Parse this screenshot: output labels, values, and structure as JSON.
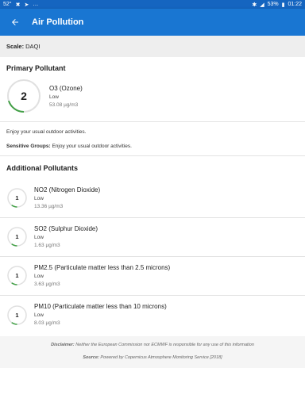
{
  "status_bar": {
    "left_text": "52°",
    "icons": [
      "notification-x-icon",
      "location-icon",
      "more-icon"
    ],
    "battery": "53%",
    "time": "01:22"
  },
  "app_bar": {
    "title": "Air Pollution"
  },
  "scale": {
    "label": "Scale:",
    "value": "DAQI"
  },
  "primary": {
    "heading": "Primary Pollutant",
    "index": "2",
    "index_fraction": 0.2,
    "name": "O3 (Ozone)",
    "level": "Low",
    "value": "53.08 µg/m3"
  },
  "advice": {
    "general": "Enjoy your usual outdoor activities.",
    "sensitive_label": "Sensitive Groups:",
    "sensitive_text": "Enjoy your usual outdoor activities."
  },
  "additional": {
    "heading": "Additional Pollutants",
    "items": [
      {
        "index": "1",
        "index_fraction": 0.1,
        "name": "NO2 (Nitrogen Dioxide)",
        "level": "Low",
        "value": "13.36 µg/m3"
      },
      {
        "index": "1",
        "index_fraction": 0.1,
        "name": "SO2 (Sulphur Dioxide)",
        "level": "Low",
        "value": "1.63 µg/m3"
      },
      {
        "index": "1",
        "index_fraction": 0.1,
        "name": "PM2.5 (Particulate matter less than 2.5 microns)",
        "level": "Low",
        "value": "3.63 µg/m3"
      },
      {
        "index": "1",
        "index_fraction": 0.1,
        "name": "PM10 (Particulate matter less than 10 microns)",
        "level": "Low",
        "value": "8.03 µg/m3"
      }
    ]
  },
  "footer": {
    "disclaimer_label": "Disclaimer:",
    "disclaimer_text": "Neither the European Commission nor ECMWF is responsible for any use of this information",
    "source_label": "Source:",
    "source_text": "Powered by Copernicus Atmosphere Monitoring Service [2018]"
  },
  "colors": {
    "app_bar": "#1976d2",
    "status_bar": "#1565c0",
    "ring_track": "#e0e0e0",
    "ring_level": "#43a047"
  }
}
